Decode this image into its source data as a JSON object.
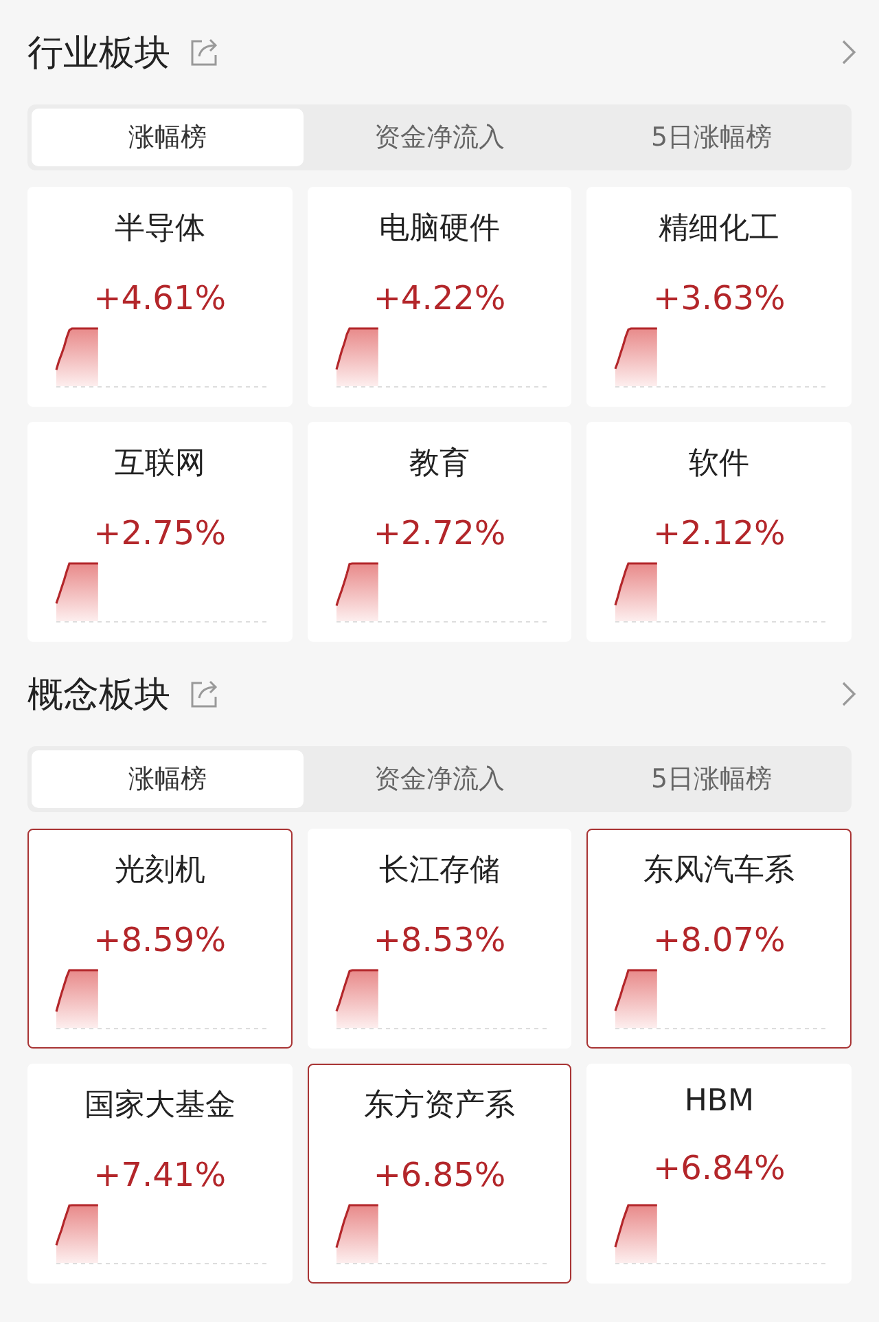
{
  "sections": [
    {
      "title": "行业板块",
      "tabs": [
        {
          "label": "涨幅榜",
          "selected": true
        },
        {
          "label": "资金净流入",
          "selected": false
        },
        {
          "label": "5日涨幅榜",
          "selected": false
        }
      ],
      "cards": [
        {
          "name": "半导体",
          "change": "+4.61%",
          "highlighted": false
        },
        {
          "name": "电脑硬件",
          "change": "+4.22%",
          "highlighted": false
        },
        {
          "name": "精细化工",
          "change": "+3.63%",
          "highlighted": false
        },
        {
          "name": "互联网",
          "change": "+2.75%",
          "highlighted": false
        },
        {
          "name": "教育",
          "change": "+2.72%",
          "highlighted": false
        },
        {
          "name": "软件",
          "change": "+2.12%",
          "highlighted": false
        }
      ]
    },
    {
      "title": "概念板块",
      "tabs": [
        {
          "label": "涨幅榜",
          "selected": true
        },
        {
          "label": "资金净流入",
          "selected": false
        },
        {
          "label": "5日涨幅榜",
          "selected": false
        }
      ],
      "cards": [
        {
          "name": "光刻机",
          "change": "+8.59%",
          "highlighted": true
        },
        {
          "name": "长江存储",
          "change": "+8.53%",
          "highlighted": false
        },
        {
          "name": "东风汽车系",
          "change": "+8.07%",
          "highlighted": true
        },
        {
          "name": "国家大基金",
          "change": "+7.41%",
          "highlighted": false
        },
        {
          "name": "东方资产系",
          "change": "+6.85%",
          "highlighted": true
        },
        {
          "name": "HBM",
          "change": "+6.84%",
          "highlighted": false
        }
      ]
    }
  ]
}
